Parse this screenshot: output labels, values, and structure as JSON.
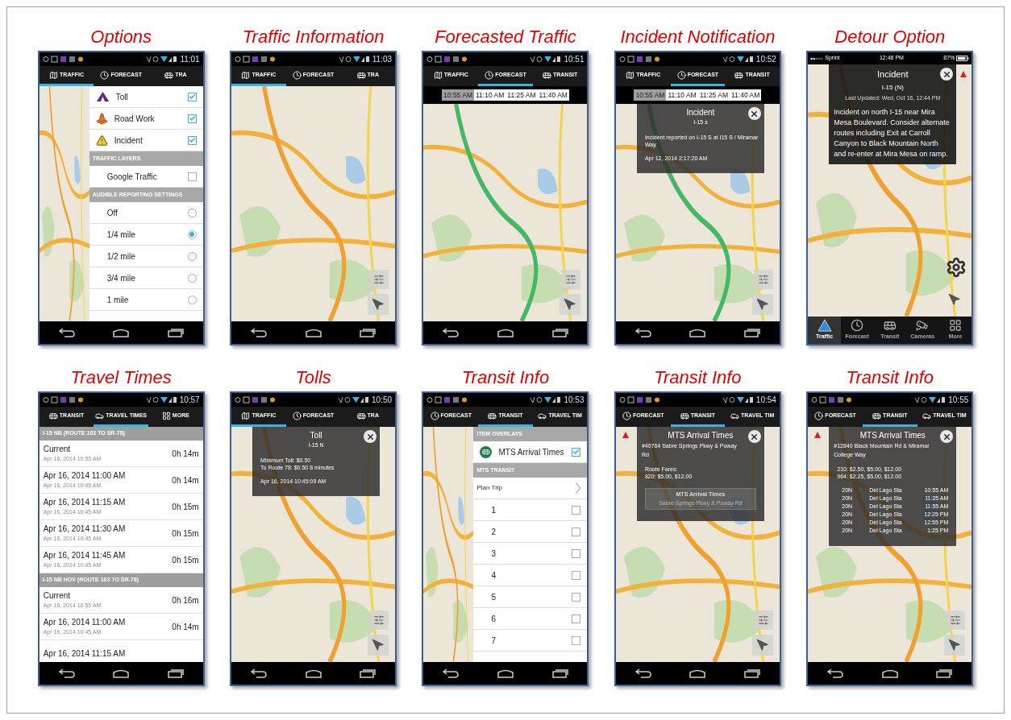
{
  "figures": [
    {
      "caption": "Options",
      "phone": {
        "kind": "android",
        "time": "11:01",
        "tabs": [
          {
            "kind": "traffic",
            "label": "TRAFFIC",
            "selected": true
          },
          {
            "kind": "forecast",
            "label": "FORECAST",
            "selected": false
          },
          {
            "kind": "transit",
            "label": "TRA",
            "selected": false
          }
        ],
        "screen": {
          "kind": "panel",
          "rows": [
            {
              "kind": "toll",
              "label": "Toll",
              "checked": true
            },
            {
              "kind": "roadwork",
              "label": "Road Work",
              "checked": true
            },
            {
              "kind": "incident",
              "label": "Incident",
              "checked": true
            },
            {
              "kind": "header",
              "label": "TRAFFIC LAYERS"
            },
            {
              "kind": "check",
              "label": "Google Traffic",
              "checked": false
            },
            {
              "kind": "header",
              "label": "AUDIBLE REPORTING SETTINGS"
            },
            {
              "kind": "radio",
              "label": "Off",
              "selected": false
            },
            {
              "kind": "radio",
              "label": "1/4 mile",
              "selected": true
            },
            {
              "kind": "radio",
              "label": "1/2 mile",
              "selected": false
            },
            {
              "kind": "radio",
              "label": "3/4 mile",
              "selected": false
            },
            {
              "kind": "radio",
              "label": "1 mile",
              "selected": false
            }
          ]
        }
      }
    },
    {
      "caption": "Traffic Information",
      "phone": {
        "kind": "android",
        "time": "11:03",
        "tabs": [
          {
            "kind": "traffic",
            "label": "TRAFFIC",
            "selected": true
          },
          {
            "kind": "forecast",
            "label": "FORECAST",
            "selected": false
          },
          {
            "kind": "transit",
            "label": "TRA",
            "selected": false
          }
        ],
        "screen": {
          "kind": "map",
          "compass": false
        }
      }
    },
    {
      "caption": "Forecasted Traffic",
      "phone": {
        "kind": "android",
        "time": "10:51",
        "tabs": [
          {
            "kind": "traffic",
            "label": "TRAFFIC",
            "selected": false
          },
          {
            "kind": "forecast",
            "label": "FORECAST",
            "selected": true
          },
          {
            "kind": "transit",
            "label": "TRANSIT",
            "selected": false
          }
        ],
        "screen": {
          "kind": "map",
          "compass": false,
          "slots": [
            {
              "label": "10:55 AM",
              "selected": true
            },
            {
              "label": "11:10 AM",
              "selected": false
            },
            {
              "label": "11:25 AM",
              "selected": false
            },
            {
              "label": "11:40 AM",
              "selected": false
            }
          ]
        }
      }
    },
    {
      "caption": "Incident Notification",
      "phone": {
        "kind": "android",
        "time": "10:52",
        "tabs": [
          {
            "kind": "traffic",
            "label": "TRAFFIC",
            "selected": false
          },
          {
            "kind": "forecast",
            "label": "FORECAST",
            "selected": true
          },
          {
            "kind": "transit",
            "label": "TRANSIT",
            "selected": false
          }
        ],
        "screen": {
          "kind": "map",
          "compass": false,
          "slots": [
            {
              "label": "10:55 AM",
              "selected": true
            },
            {
              "label": "11:10 AM",
              "selected": false
            },
            {
              "label": "11:25 AM",
              "selected": false
            },
            {
              "label": "11:40 AM",
              "selected": false
            }
          ],
          "popup": {
            "title": "Incident",
            "subtitle": "I-15 s",
            "paragraphs": [
              [
                "Incident reported on I-15 S at I15 S / Miramar Way"
              ],
              [
                "Apr 12, 2014 2:17:20 AM"
              ]
            ]
          }
        }
      }
    },
    {
      "caption": "Detour Option",
      "phone": {
        "kind": "ios",
        "carrier": "Sprint",
        "time": "12:48 PM",
        "battery": "87%",
        "tabs": [
          {
            "kind": "traffic",
            "label": "Traffic",
            "selected": true
          },
          {
            "kind": "forecast",
            "label": "Forecast",
            "selected": false
          },
          {
            "kind": "transit",
            "label": "Transit",
            "selected": false
          },
          {
            "kind": "cameras",
            "label": "Cameras",
            "selected": false
          },
          {
            "kind": "more",
            "label": "More",
            "selected": false
          }
        ],
        "screen": {
          "kind": "map",
          "compass": true,
          "popup": {
            "title": "Incident",
            "subtitle": "I-15 (N)",
            "meta": "Last Updated: Wed, Oct 16, 12:44 PM",
            "paragraphs": [
              [
                "Incident on north I-15 near Mira Mesa Boulevard. Consider alternate routes including Exit at Carroll Canyon to Black Mountain North and re-enter at Mira Mesa on ramp."
              ]
            ]
          }
        }
      }
    },
    {
      "caption": "Travel Times",
      "phone": {
        "kind": "android",
        "time": "10:57",
        "tabs": [
          {
            "kind": "transit",
            "label": "TRANSIT",
            "selected": false
          },
          {
            "kind": "travel",
            "label": "TRAVEL TIMES",
            "selected": true
          },
          {
            "kind": "more",
            "label": "MORE",
            "selected": false
          }
        ],
        "screen": {
          "kind": "times",
          "sections": [
            {
              "header": "I-15 NB (ROUTE 163 TO SR-78)",
              "rows": [
                {
                  "label": "Current",
                  "note": "Apr 16, 2014 10:55 AM",
                  "value": "0h 14m"
                },
                {
                  "label": "Apr 16, 2014 11:00 AM",
                  "note": "Apr 16, 2014 10:45 AM",
                  "value": "0h 14m"
                },
                {
                  "label": "Apr 16, 2014 11:15 AM",
                  "note": "Apr 16, 2014 10:45 AM",
                  "value": "0h 15m"
                },
                {
                  "label": "Apr 16, 2014 11:30 AM",
                  "note": "Apr 16, 2014 10:45 AM",
                  "value": "0h 15m"
                },
                {
                  "label": "Apr 16, 2014 11:45 AM",
                  "note": "Apr 16, 2014 10:45 AM",
                  "value": "0h 15m"
                }
              ]
            },
            {
              "header": "I-15 NB HOV (ROUTE 163 TO SR-78)",
              "rows": [
                {
                  "label": "Current",
                  "note": "Apr 16, 2014 10:55 AM",
                  "value": "0h 16m"
                },
                {
                  "label": "Apr 16, 2014 11:00 AM",
                  "note": "Apr 16, 2014 10:45 AM",
                  "value": "0h 14m"
                },
                {
                  "label": "Apr 16, 2014 11:15 AM"
                }
              ]
            }
          ]
        }
      }
    },
    {
      "caption": "Tolls",
      "phone": {
        "kind": "android",
        "time": "10:50",
        "tabs": [
          {
            "kind": "traffic",
            "label": "TRAFFIC",
            "selected": true
          },
          {
            "kind": "forecast",
            "label": "FORECAST",
            "selected": false
          },
          {
            "kind": "transit",
            "label": "TRA",
            "selected": false
          }
        ],
        "screen": {
          "kind": "map",
          "compass": false,
          "popup": {
            "title": "Toll",
            "subtitle": "I-15 N",
            "paragraphs": [
              [
                "Minimum Toll: $0.50",
                "To Route 78: $0.50 8 minutes"
              ],
              [
                "Apr 16, 2014 10:45:09 AM"
              ]
            ]
          }
        }
      }
    },
    {
      "caption": "Transit Info",
      "phone": {
        "kind": "android",
        "time": "10:53",
        "tabs": [
          {
            "kind": "forecast",
            "label": "FORECAST",
            "selected": false
          },
          {
            "kind": "transit",
            "label": "TRANSIT",
            "selected": true
          },
          {
            "kind": "travel",
            "label": "TRAVEL TIM",
            "selected": false
          }
        ],
        "screen": {
          "kind": "panel",
          "rows": [
            {
              "kind": "header",
              "label": "ITEM OVERLAYS"
            },
            {
              "kind": "transit",
              "label": "MTS Arrival Times",
              "checked": true
            },
            {
              "kind": "header",
              "label": "MTS TRANSIT"
            },
            {
              "kind": "link",
              "label": "Plan Trip"
            },
            {
              "kind": "check",
              "label": "1",
              "checked": false
            },
            {
              "kind": "check",
              "label": "2",
              "checked": false
            },
            {
              "kind": "check",
              "label": "3",
              "checked": false
            },
            {
              "kind": "check",
              "label": "4",
              "checked": false
            },
            {
              "kind": "check",
              "label": "5",
              "checked": false
            },
            {
              "kind": "check",
              "label": "6",
              "checked": false
            },
            {
              "kind": "check",
              "label": "7",
              "checked": false
            }
          ]
        }
      }
    },
    {
      "caption": "Transit Info",
      "phone": {
        "kind": "android",
        "time": "10:54",
        "tabs": [
          {
            "kind": "forecast",
            "label": "FORECAST",
            "selected": false
          },
          {
            "kind": "transit",
            "label": "TRANSIT",
            "selected": true
          },
          {
            "kind": "travel",
            "label": "TRAVEL TIM",
            "selected": false
          }
        ],
        "screen": {
          "kind": "map",
          "compass": true,
          "popup": {
            "title": "MTS Arrival Times",
            "address": "#40764 Sabre Springs Pkwy & Poway Rd",
            "paragraphs": [
              [
                "Route Fares:",
                "820: $5.00, $12.00"
              ]
            ],
            "callout": {
              "title": "MTS Arrival Times",
              "subtitle": "Sabre Springs Pkwy & Poway Rd"
            }
          }
        }
      }
    },
    {
      "caption": "Transit Info",
      "phone": {
        "kind": "android",
        "time": "10:55",
        "tabs": [
          {
            "kind": "forecast",
            "label": "FORECAST",
            "selected": false
          },
          {
            "kind": "transit",
            "label": "TRANSIT",
            "selected": true
          },
          {
            "kind": "travel",
            "label": "TRAVEL TIM",
            "selected": false
          }
        ],
        "screen": {
          "kind": "map",
          "compass": true,
          "popup": {
            "title": "MTS Arrival Times",
            "address": "#12840 Black Mountain Rd & Miramar College Way",
            "paragraphs": [
              [
                "210: $2.50, $5.00, $12.00",
                "964: $2.25, $5.00, $12.00"
              ]
            ],
            "arrivals": [
              {
                "route": "20N",
                "stop": "Del Lago Sta",
                "time": "10:55 AM"
              },
              {
                "route": "20N",
                "stop": "Del Lago Sta",
                "time": "11:25 AM"
              },
              {
                "route": "20N",
                "stop": "Del Lago Sta",
                "time": "11:55 AM"
              },
              {
                "route": "20N",
                "stop": "Del Lago Sta",
                "time": "12:25 PM"
              },
              {
                "route": "20N",
                "stop": "Del Lago Sta",
                "time": "12:55 PM"
              },
              {
                "route": "20N",
                "stop": "Del Lago Sta",
                "time": "1:25 PM"
              }
            ]
          }
        }
      }
    }
  ]
}
